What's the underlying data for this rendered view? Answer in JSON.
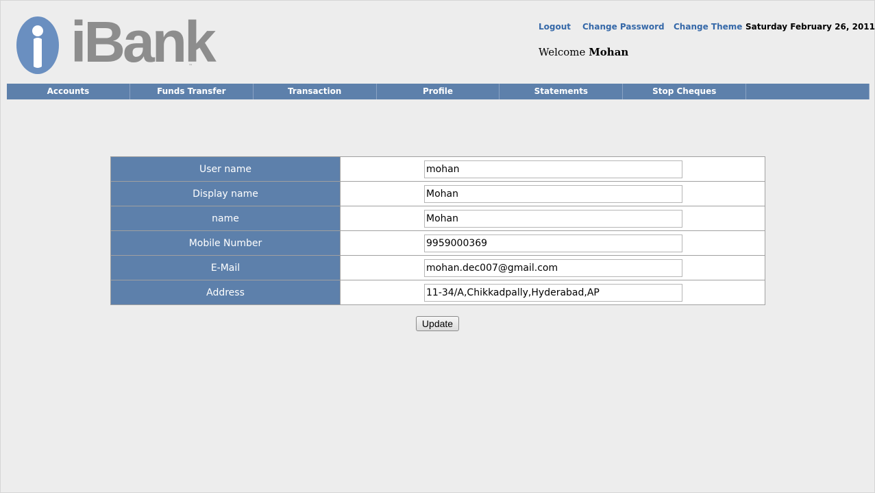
{
  "brand": {
    "name": "iBank",
    "trademark": "™",
    "logo_color": "#6a8fc0",
    "text_color": "#8d8d8d"
  },
  "header": {
    "links": {
      "logout": "Logout",
      "change_password": "Change Password",
      "change_theme": "Change Theme"
    },
    "date": "Saturday February 26, 2011",
    "welcome_prefix": "Welcome",
    "user_name": "Mohan"
  },
  "nav": {
    "items": [
      {
        "label": "Accounts"
      },
      {
        "label": "Funds Transfer"
      },
      {
        "label": "Transaction"
      },
      {
        "label": "Profile"
      },
      {
        "label": "Statements"
      },
      {
        "label": "Stop Cheques"
      },
      {
        "label": ""
      }
    ]
  },
  "form": {
    "rows": [
      {
        "label": "User name",
        "value": "mohan"
      },
      {
        "label": "Display name",
        "value": "Mohan"
      },
      {
        "label": "name",
        "value": "Mohan"
      },
      {
        "label": "Mobile Number",
        "value": "9959000369"
      },
      {
        "label": "E-Mail",
        "value": "mohan.dec007@gmail.com"
      },
      {
        "label": "Address",
        "value": "11-34/A,Chikkadpally,Hyderabad,AP"
      }
    ],
    "update_label": "Update"
  },
  "colors": {
    "accent": "#5d80ab",
    "link": "#3568a8",
    "background": "#ededed"
  }
}
